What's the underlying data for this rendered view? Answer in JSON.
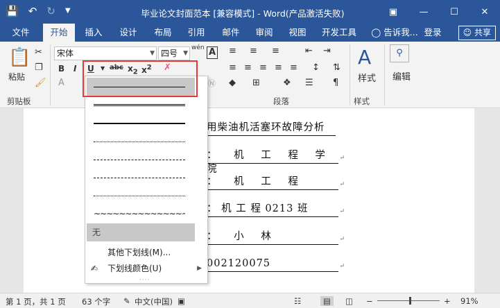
{
  "titlebar": {
    "title": "毕业论文封面范本 [兼容模式] - Word(产品激活失败)",
    "save_icon": "save-icon",
    "undo_icon": "undo-icon",
    "redo_icon": "redo-icon",
    "customize_icon": "customize-qat-icon",
    "restore_icon": "ribbon-display-icon",
    "minimize": "—",
    "maximize": "☐",
    "close": "✕"
  },
  "tabs": {
    "items": [
      "文件",
      "开始",
      "插入",
      "设计",
      "布局",
      "引用",
      "邮件",
      "审阅",
      "视图",
      "开发工具"
    ],
    "tell_me": "告诉我...",
    "signin": "登录",
    "share": "共享"
  },
  "ribbon": {
    "clipboard": {
      "paste": "粘贴",
      "label": "剪贴板"
    },
    "font": {
      "name": "宋体",
      "size": "四号",
      "wen": "wén",
      "a": "A"
    },
    "paragraph": {
      "label": "段落"
    },
    "styles": {
      "label": "样式",
      "button": "样式"
    },
    "editing": {
      "button": "编辑"
    }
  },
  "underline_menu": {
    "none": "无",
    "more": "其他下划线(M)...",
    "color": "下划线颜色(U)"
  },
  "document": {
    "lines": [
      "用柴油机活塞环故障分析",
      "：  机  工  程  学  院",
      "：  机  工  程",
      "：  机 工   程    0213 班",
      "：  小  林",
      "002120075"
    ]
  },
  "status": {
    "page": "第 1 页，共 1 页",
    "words": "63 个字",
    "lang": "中文(中国)",
    "zoom": "91%"
  },
  "colors": {
    "brand": "#2b579a",
    "highlight_box": "#e53935"
  }
}
